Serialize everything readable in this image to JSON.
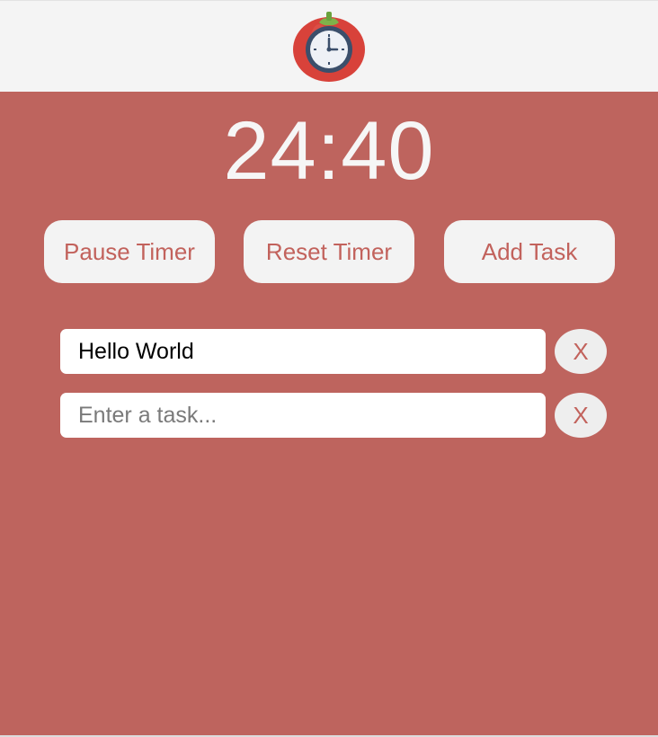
{
  "logo": {
    "icon": "tomato-clock-icon",
    "colors": {
      "tomato": "#d8423a",
      "leaf": "#7fb24a",
      "clock_face": "#eef1f6",
      "clock_rim": "#3b4f6b"
    }
  },
  "timer": {
    "display": "24:40"
  },
  "buttons": {
    "pause_label": "Pause Timer",
    "reset_label": "Reset Timer",
    "add_label": "Add Task"
  },
  "tasks": [
    {
      "value": "Hello World",
      "placeholder": "Enter a task...",
      "remove_label": "X"
    },
    {
      "value": "",
      "placeholder": "Enter a task...",
      "remove_label": "X"
    }
  ],
  "colors": {
    "background_main": "#be645e",
    "header_background": "#f4f4f4",
    "button_background": "#f3f3f3",
    "accent_text": "#c2625c",
    "timer_text": "#f6f6f6"
  }
}
